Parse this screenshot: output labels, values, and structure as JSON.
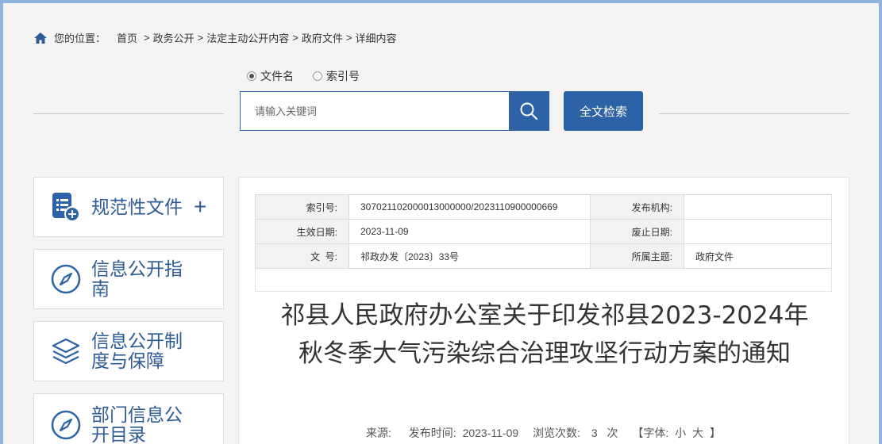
{
  "breadcrumb": {
    "label": "您的位置：",
    "items": [
      "首页",
      "政务公开",
      "法定主动公开内容",
      "政府文件",
      "详细内容"
    ],
    "separator": ">"
  },
  "search": {
    "options": [
      {
        "label": "文件名",
        "checked": true
      },
      {
        "label": "索引号",
        "checked": false
      }
    ],
    "placeholder": "请输入关键词",
    "value": "",
    "fulltext_label": "全文检索"
  },
  "sidebar": {
    "items": [
      {
        "label": "规范性文件",
        "icon": "document-plus-icon",
        "expand": "+"
      },
      {
        "label_line1": "信息公开指",
        "label_line2": "南",
        "icon": "compass-icon"
      },
      {
        "label_line1": "信息公开制",
        "label_line2": "度与保障",
        "icon": "layers-icon"
      },
      {
        "label_line1": "部门信息公",
        "label_line2": "开目录",
        "icon": "compass-icon"
      }
    ]
  },
  "meta": {
    "index_no_label": "索引号:",
    "index_no": "307021102000013000000/2023110900000669",
    "publisher_label": "发布机构:",
    "publisher": "",
    "effective_label": "生效日期:",
    "effective": "2023-11-09",
    "abolish_label": "废止日期:",
    "abolish": "",
    "doc_no_label": "文  号:",
    "doc_no": "祁政办发〔2023〕33号",
    "topic_label": "所属主题:",
    "topic": "政府文件"
  },
  "article": {
    "title": "祁县人民政府办公室关于印发祁县2023-2024年秋冬季大气污染综合治理攻坚行动方案的通知",
    "source_label": "来源:",
    "source": "",
    "date_label": "发布时间:",
    "date": "2023-11-09",
    "views_label": "浏览次数:",
    "views": "3",
    "views_unit": "次",
    "font_label": "【字体:",
    "font_small": "小",
    "font_big": "大",
    "font_close": "】"
  },
  "colors": {
    "accent": "#2d63a6",
    "nav_text": "#2d5b95",
    "frame": "#8fb3dc"
  }
}
